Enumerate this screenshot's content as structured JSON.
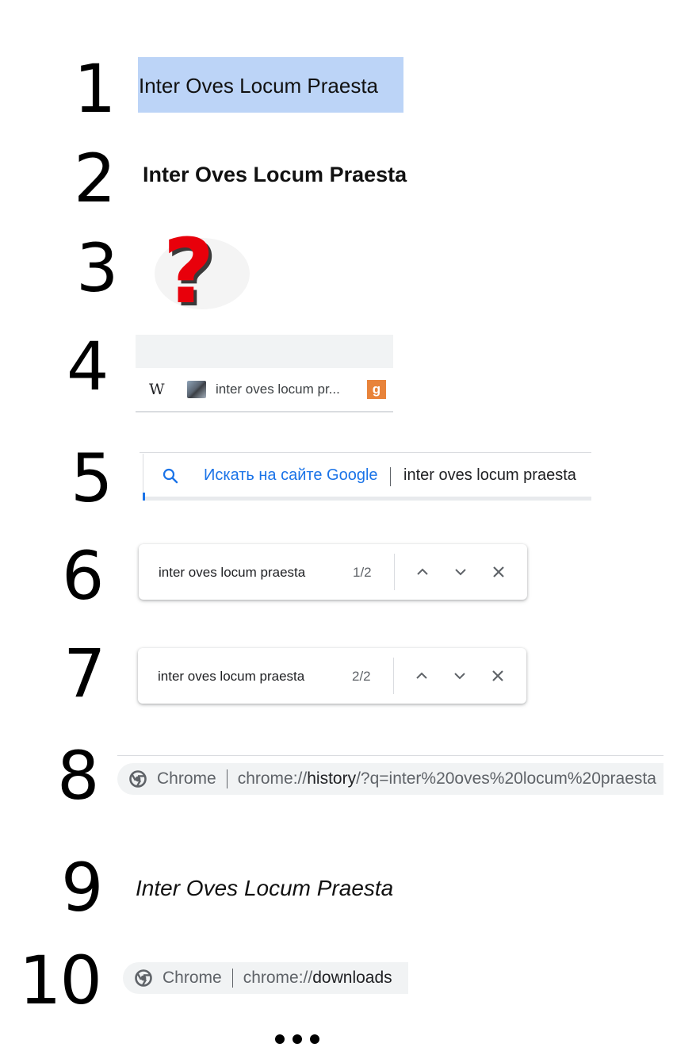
{
  "steps": [
    "1",
    "2",
    "3",
    "4",
    "5",
    "6",
    "7",
    "8",
    "9",
    "10"
  ],
  "step1": {
    "selected_text": "Inter Oves Locum Praesta"
  },
  "step2": {
    "bold_text": "Inter Oves Locum Praesta"
  },
  "step3": {
    "icon": "red-question-mark-icon",
    "color": "#e8000b"
  },
  "step4": {
    "tabs": [
      {
        "icon": "wikipedia-icon",
        "label": "W"
      },
      {
        "icon": "avatar-favicon"
      },
      {
        "title": "inter oves locum pr..."
      },
      {
        "icon": "orange-g-favicon",
        "label": "g"
      }
    ]
  },
  "step5": {
    "hint": "Искать на сайте Google",
    "query": "inter oves locum praesta"
  },
  "step6": {
    "query": "inter oves locum praesta",
    "count": "1/2"
  },
  "step7": {
    "query": "inter oves locum praesta",
    "count": "2/2"
  },
  "step8": {
    "site": "Chrome",
    "url_prefix": "chrome://",
    "url_host": "history",
    "url_rest": "/?q=inter%20oves%20locum%20praesta"
  },
  "step9": {
    "italic_text": "Inter Oves Locum Praesta"
  },
  "step10": {
    "site": "Chrome",
    "url_prefix": "chrome://",
    "url_host": "downloads"
  },
  "colors": {
    "selection": "#bcd4f7",
    "link_blue": "#1a73e8",
    "accent_orange": "#e8833a"
  }
}
